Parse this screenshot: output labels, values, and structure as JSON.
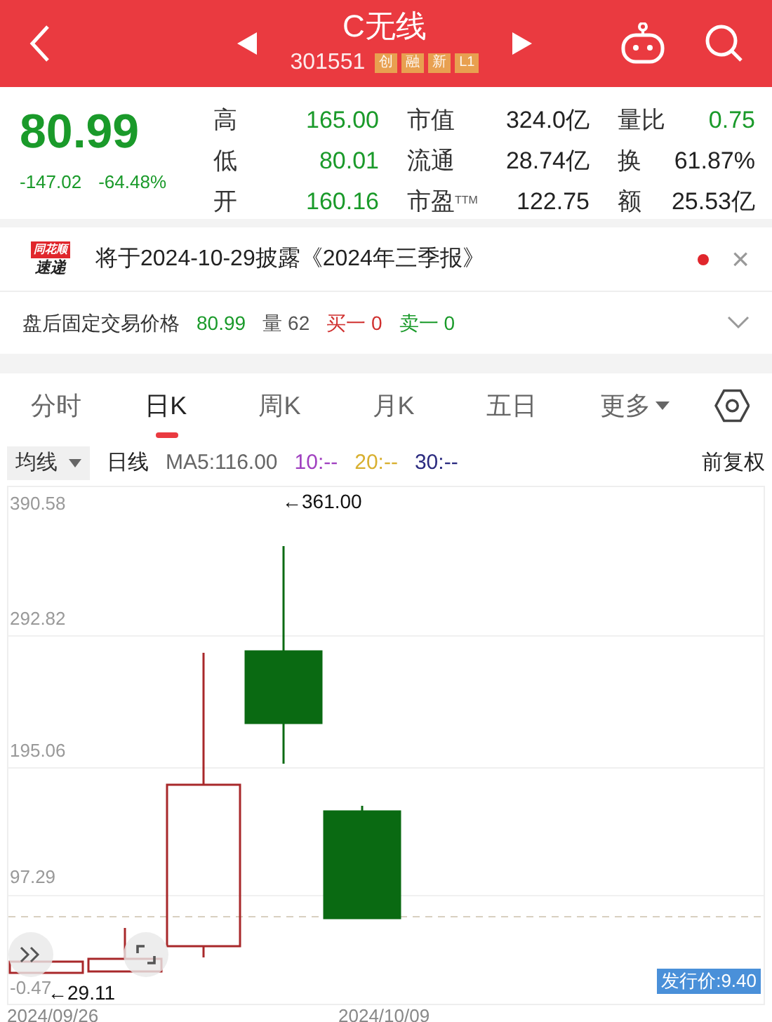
{
  "header": {
    "title": "C无线",
    "code": "301551",
    "tags": [
      "创",
      "融",
      "新",
      "L1"
    ]
  },
  "quote": {
    "price": "80.99",
    "change": "-147.02",
    "change_pct": "-64.48%",
    "stats": [
      {
        "label": "高",
        "value": "165.00",
        "color": "#1a9a2a"
      },
      {
        "label": "市值",
        "value": "324.0亿",
        "color": "#222222"
      },
      {
        "label": "量比",
        "value": "0.75",
        "color": "#1a9a2a"
      },
      {
        "label": "低",
        "value": "80.01",
        "color": "#1a9a2a"
      },
      {
        "label": "流通",
        "value": "28.74亿",
        "color": "#222222"
      },
      {
        "label": "换",
        "value": "61.87%",
        "color": "#222222"
      },
      {
        "label": "开",
        "value": "160.16",
        "color": "#1a9a2a"
      },
      {
        "label": "市盈",
        "sup": "TTM",
        "value": "122.75",
        "color": "#222222"
      },
      {
        "label": "额",
        "value": "25.53亿",
        "color": "#222222"
      }
    ]
  },
  "news": {
    "logo_top": "同花顺",
    "logo_bottom": "速递",
    "text": "将于2024-10-29披露《2024年三季报》",
    "unread": true,
    "close": "×"
  },
  "after_hours": {
    "label": "盘后固定交易价格",
    "price": "80.99",
    "volume_label": "量",
    "volume": "62",
    "bid": "买一 0",
    "ask": "卖一 0"
  },
  "tabs": [
    {
      "label": "分时",
      "selected": false
    },
    {
      "label": "日K",
      "selected": true
    },
    {
      "label": "周K",
      "selected": false
    },
    {
      "label": "月K",
      "selected": false
    },
    {
      "label": "五日",
      "selected": false
    },
    {
      "label": "更多",
      "selected": false,
      "dropdown": true
    }
  ],
  "indicators": {
    "selector": "均线",
    "type": "日线",
    "items": [
      {
        "text": "MA5:116.00",
        "color": "#666666"
      },
      {
        "text": "10:--",
        "color": "#a040c0"
      },
      {
        "text": "20:--",
        "color": "#d8b030"
      },
      {
        "text": "30:--",
        "color": "#2a2a80"
      }
    ],
    "adjust": "前复权"
  },
  "chart": {
    "y_labels": [
      "390.58",
      "292.82",
      "195.06",
      "97.29",
      "-0.47"
    ],
    "high_marker": "←361.00",
    "low_marker": "←29.11",
    "issue_price": "发行价:9.40",
    "dates": [
      "2024/09/26",
      "2024/10/09"
    ]
  }
}
